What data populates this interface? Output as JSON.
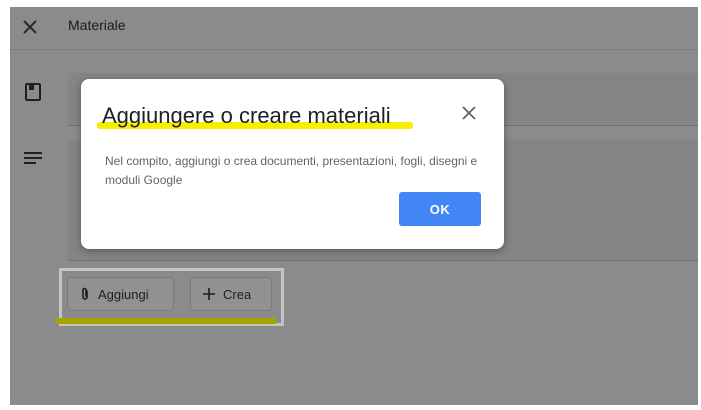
{
  "header": {
    "title": "Materiale"
  },
  "dialog": {
    "title": "Aggiungere o creare materiali",
    "body": "Nel compito, aggiungi o crea documenti, presentazioni, fogli, disegni e moduli Google",
    "ok_label": "OK"
  },
  "attach": {
    "add_label": "Aggiungi",
    "create_label": "Crea"
  },
  "icons": {
    "close": "close-icon",
    "note": "note-icon",
    "description": "lines-icon",
    "attach": "paperclip-icon",
    "create": "plus-icon"
  },
  "colors": {
    "accent": "#4285f4",
    "highlight": "#f7ef00",
    "underline": "#a6a600",
    "overlay": "#8b8b8b"
  }
}
